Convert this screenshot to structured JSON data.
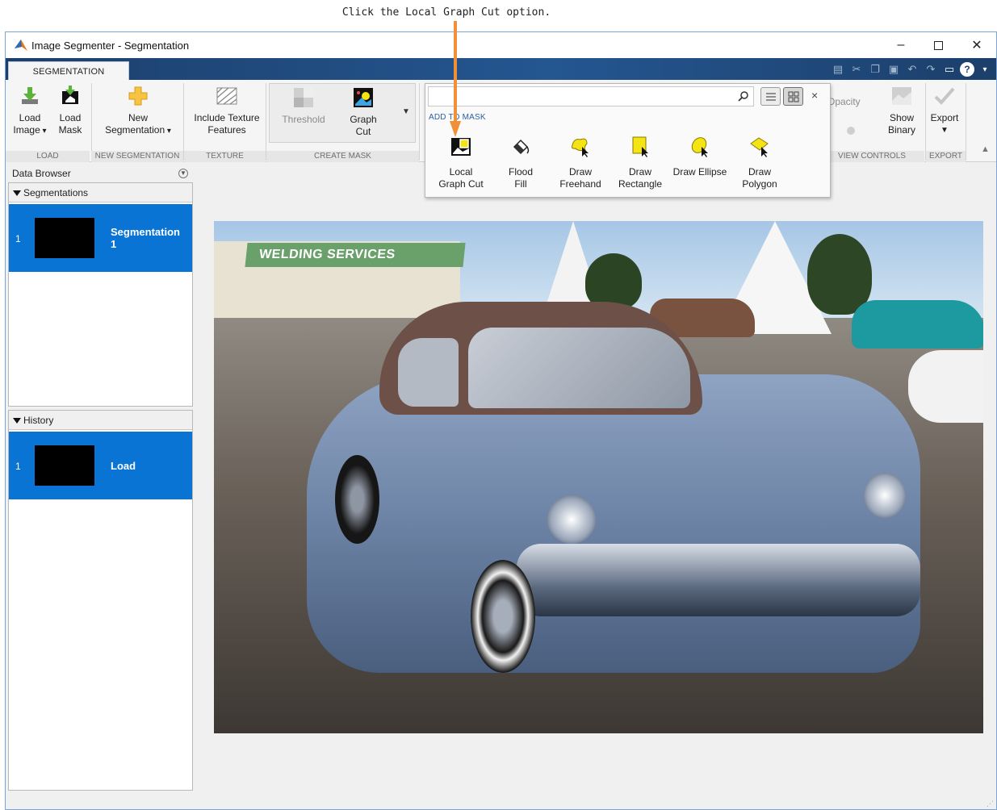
{
  "callout": {
    "text": "Click the Local Graph Cut option."
  },
  "window": {
    "title": "Image Segmenter - Segmentation",
    "controls": {
      "minimize": "–",
      "close": "✕"
    }
  },
  "ribbon": {
    "tab": "SEGMENTATION",
    "load": {
      "load_image_line1": "Load",
      "load_image_line2": "Image",
      "load_mask_line1": "Load",
      "load_mask_line2": "Mask",
      "group": "LOAD"
    },
    "new_segmentation": {
      "line1": "New",
      "line2": "Segmentation",
      "group": "NEW SEGMENTATION"
    },
    "texture": {
      "line1": "Include Texture",
      "line2": "Features",
      "group": "TEXTURE"
    },
    "create_mask": {
      "threshold": "Threshold",
      "graph_cut_line1": "Graph",
      "graph_cut_line2": "Cut",
      "group": "CREATE MASK"
    },
    "view_controls": {
      "opacity": "Opacity",
      "show_binary_line1": "Show",
      "show_binary_line2": "Binary",
      "group": "VIEW CONTROLS"
    },
    "export": {
      "label": "Export",
      "group": "EXPORT"
    }
  },
  "popup": {
    "search_placeholder": "",
    "section": "ADD TO MASK",
    "close": "×",
    "items": [
      {
        "line1": "Local",
        "line2": "Graph Cut"
      },
      {
        "line1": "Flood",
        "line2": "Fill"
      },
      {
        "line1": "Draw",
        "line2": "Freehand"
      },
      {
        "line1": "Draw",
        "line2": "Rectangle"
      },
      {
        "line1": "Draw Ellipse",
        "line2": ""
      },
      {
        "line1": "Draw",
        "line2": "Polygon"
      }
    ]
  },
  "data_browser": {
    "title": "Data Browser",
    "segmentations": {
      "header": "Segmentations",
      "items": [
        {
          "index": "1",
          "name": "Segmentation 1"
        }
      ]
    },
    "history": {
      "header": "History",
      "items": [
        {
          "index": "1",
          "name": "Load"
        }
      ]
    }
  },
  "image": {
    "sign_text": "WELDING SERVICES"
  },
  "colors": {
    "accent": "#0a74d4",
    "tabstrip": "#1f4e79",
    "arrow": "#f0913a"
  }
}
